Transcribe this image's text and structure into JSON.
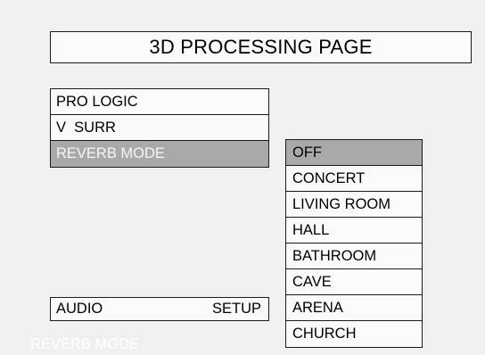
{
  "page_title": "3D PROCESSING PAGE",
  "main_menu": {
    "items": [
      {
        "label": "PRO LOGIC",
        "selected": false
      },
      {
        "label": "V  SURR",
        "selected": false
      },
      {
        "label": "REVERB MODE",
        "selected": true
      }
    ]
  },
  "options_menu": {
    "items": [
      {
        "label": "OFF",
        "selected": true
      },
      {
        "label": "CONCERT",
        "selected": false
      },
      {
        "label": "LIVING ROOM",
        "selected": false
      },
      {
        "label": "HALL",
        "selected": false
      },
      {
        "label": "BATHROOM",
        "selected": false
      },
      {
        "label": "CAVE",
        "selected": false
      },
      {
        "label": "ARENA",
        "selected": false
      },
      {
        "label": "CHURCH",
        "selected": false
      }
    ]
  },
  "bottom_nav": {
    "left_label": "AUDIO",
    "right_label": "SETUP"
  },
  "status_text": "REVERB MODE",
  "colors": {
    "background": "#f0f0f0",
    "box_background": "#fafafa",
    "highlight": "#a9a9a9",
    "highlight_text": "#f6f6f6",
    "status_text": "#ffffff"
  }
}
